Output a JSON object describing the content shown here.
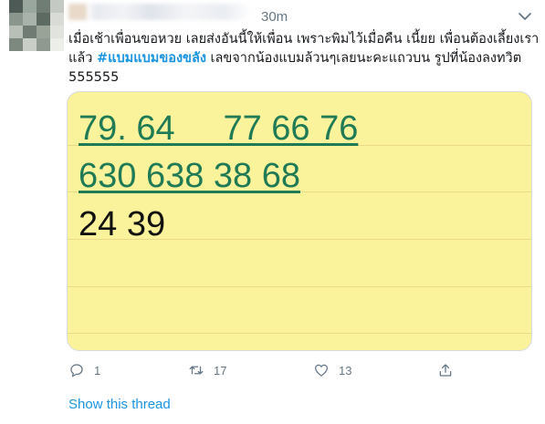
{
  "tweet": {
    "time": "30m",
    "text_line1": "เมื่อเช้าเพื่อนขอหวย เลยส่งอันนี้ให้เพื่อน เพราะพิมไว้เมื่อคืน เนี้ยย เพื่อนต้องเลี้ยงเรา",
    "text_line2_prefix": "แล้ว ",
    "hashtag": "#แบมแบมของขลัง",
    "text_line2_suffix": " เลขจากน้องแบมล้วนๆเลยนะคะแถวบน รูปที่น้องลงทวิต",
    "text_line3": "555555"
  },
  "note": {
    "line1": "79. 64     77 66 76",
    "line2": "630 638 38 68",
    "line3": "24 39"
  },
  "actions": {
    "reply_count": "1",
    "retweet_count": "17",
    "like_count": "13"
  },
  "show_thread": "Show this thread",
  "colors": {
    "link": "#1b95e0",
    "note_background": "#fbf39b",
    "note_green_text": "#217a56",
    "secondary_text": "#657786"
  },
  "icons": [
    "chevron-down-icon",
    "reply-icon",
    "retweet-icon",
    "like-icon",
    "share-icon"
  ]
}
